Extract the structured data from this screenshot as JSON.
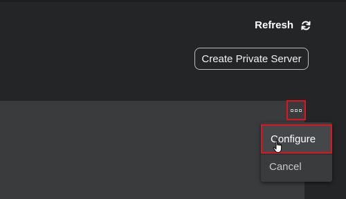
{
  "header": {
    "refresh_label": "Refresh",
    "refresh_icon": "refresh-icon",
    "create_private_server_label": "Create Private Server"
  },
  "server_row": {
    "more_icon": "more-options-icon"
  },
  "context_menu": {
    "items": [
      {
        "label": "Configure",
        "highlighted": true
      },
      {
        "label": "Cancel",
        "highlighted": false
      }
    ]
  },
  "colors": {
    "background": "#232527",
    "panel": "#393b3d",
    "highlight_border": "#e0141e",
    "text": "#ffffff"
  }
}
